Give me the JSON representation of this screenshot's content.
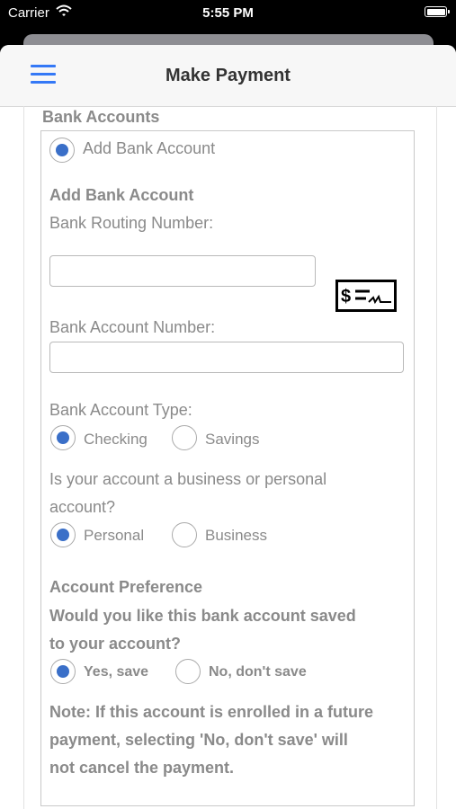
{
  "status_bar": {
    "carrier": "Carrier",
    "time": "5:55 PM"
  },
  "nav": {
    "title": "Make Payment",
    "menu_icon": "hamburger-menu-icon"
  },
  "bank_accounts": {
    "section_title": "Bank Accounts",
    "add_option_label": "Add Bank Account",
    "form_title": "Add Bank Account",
    "routing_label": "Bank Routing Number:",
    "routing_value": "",
    "check_icon": "check-icon",
    "account_number_label": "Bank Account Number:",
    "account_number_value": "",
    "account_type_label": "Bank Account Type:",
    "account_type_options": [
      "Checking",
      "Savings"
    ],
    "account_type_selected": "Checking",
    "ownership_label_line1": "Is your account a business or personal",
    "ownership_label_line2": "account?",
    "ownership_options": [
      "Personal",
      "Business"
    ],
    "ownership_selected": "Personal",
    "preference_title": "Account Preference",
    "save_question_line1": "Would you like this bank account saved",
    "save_question_line2": "to your account?",
    "save_options": [
      "Yes, save",
      "No, don't save"
    ],
    "save_selected": "Yes, save",
    "note_line1": "Note: If this account is enrolled in a future",
    "note_line2": "payment, selecting 'No, don't save' will",
    "note_line3": "not cancel the payment."
  },
  "colors": {
    "accent": "#3478f6",
    "radio_selected": "#3a6fc8",
    "label_gray": "#8a8a8a"
  }
}
